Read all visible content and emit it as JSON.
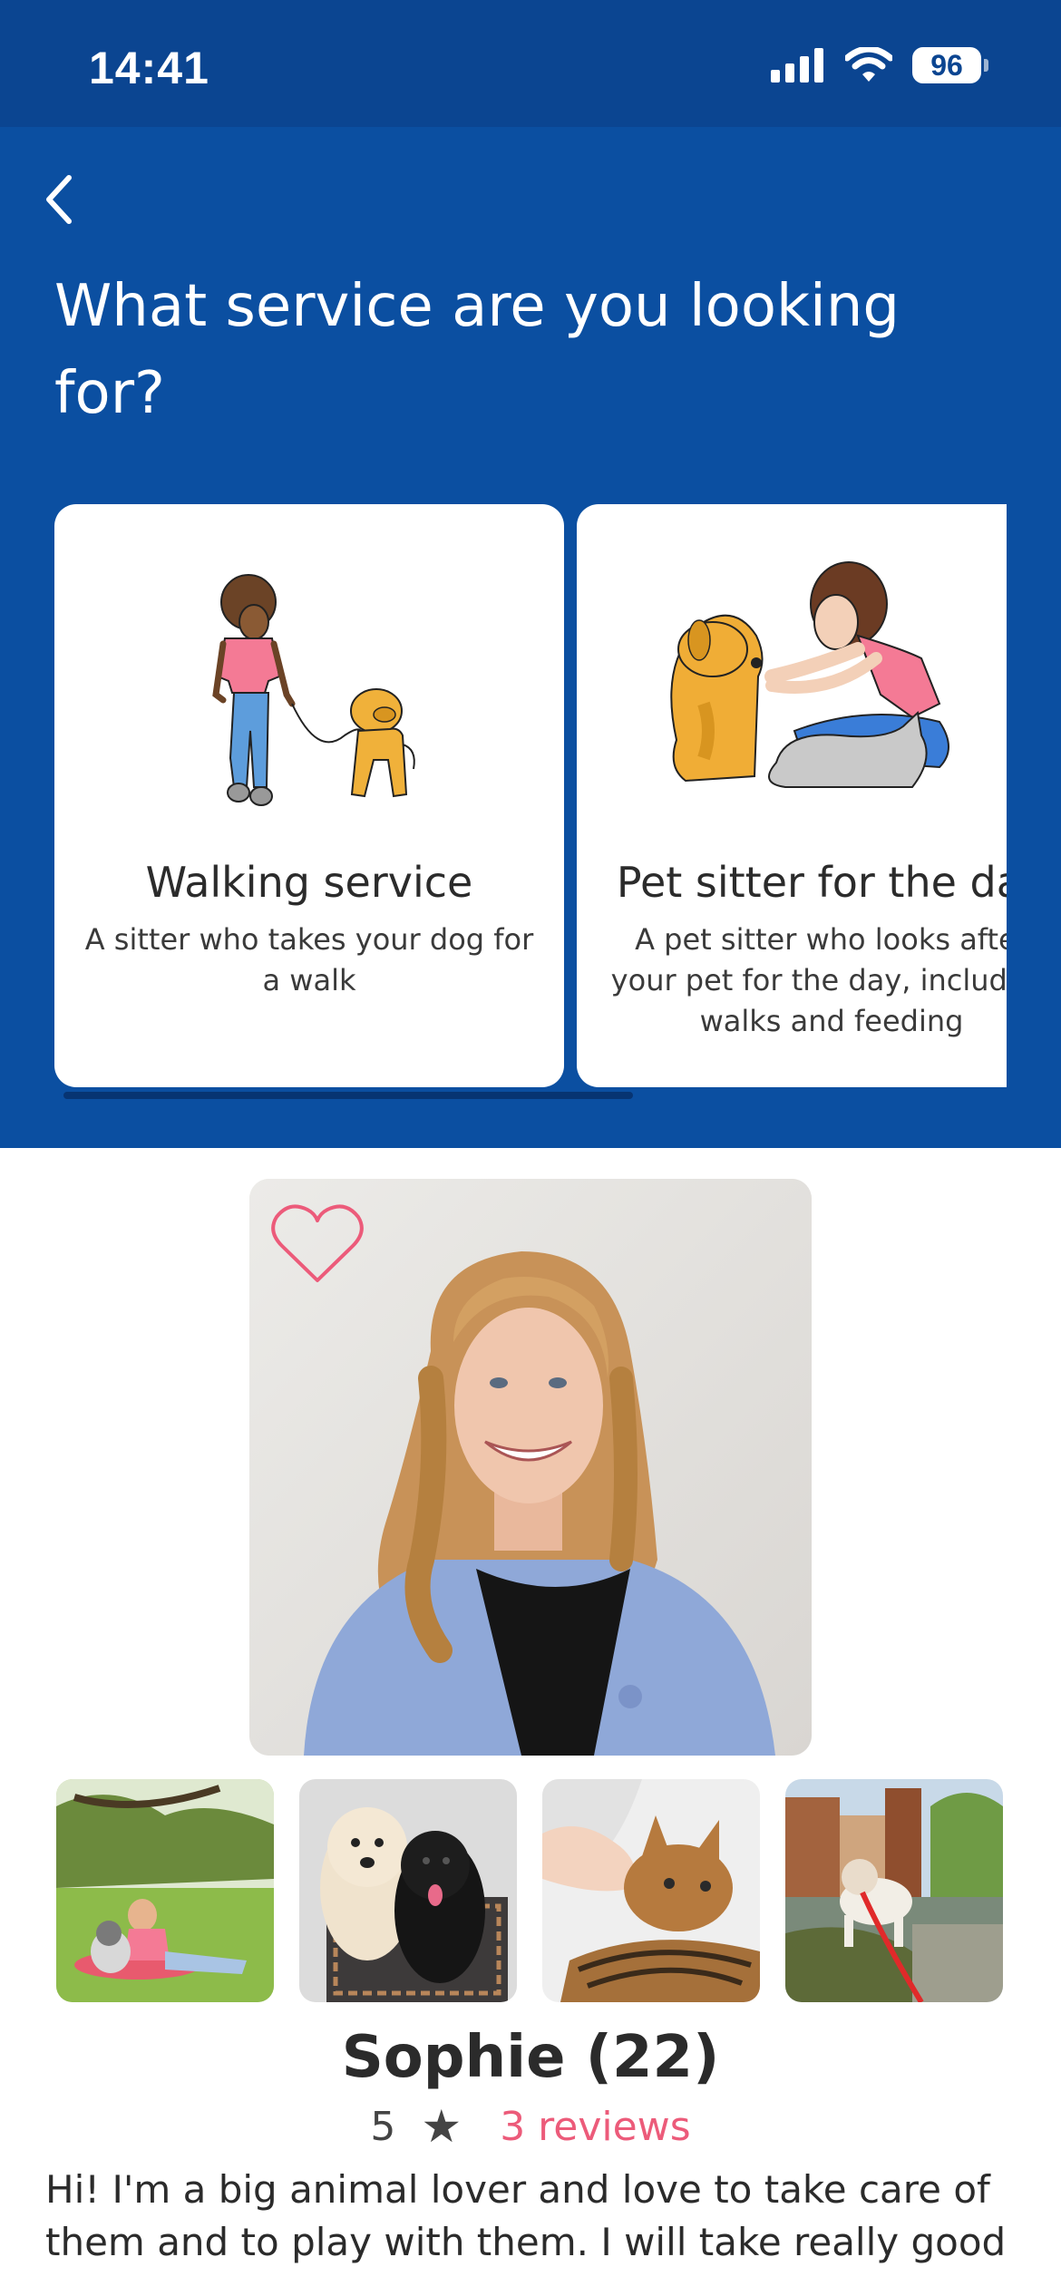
{
  "status_bar": {
    "time": "14:41",
    "battery": "96",
    "icons": [
      "signal-icon",
      "wifi-icon",
      "battery-icon"
    ]
  },
  "header": {
    "back_icon": "chevron-left-icon",
    "title": "What service are you looking for?"
  },
  "services": [
    {
      "title": "Walking service",
      "description": "A sitter who takes your dog for a walk",
      "illustration": "person-walking-dog"
    },
    {
      "title": "Pet sitter for the day",
      "description": "A pet sitter who looks after your pet for the day, including walks and feeding",
      "illustration": "person-hugging-dog-and-cat"
    }
  ],
  "profile": {
    "favorite_icon": "heart-outline-icon",
    "photos": [
      "woman-with-husky-in-park",
      "two-dogs-on-rug",
      "cat-being-petted",
      "dog-by-canal"
    ],
    "name": "Sophie (22)",
    "rating": "5",
    "star": "★",
    "reviews_label": "3 reviews",
    "bio": "Hi! I'm a big animal lover and love to take care of them and to play with them. I will take really good"
  },
  "colors": {
    "status_bar": "#0b4591",
    "header": "#0b4fa1",
    "card": "#ffffff",
    "accent_pink": "#ec5b7a",
    "text_dark": "#2b2b2b"
  }
}
